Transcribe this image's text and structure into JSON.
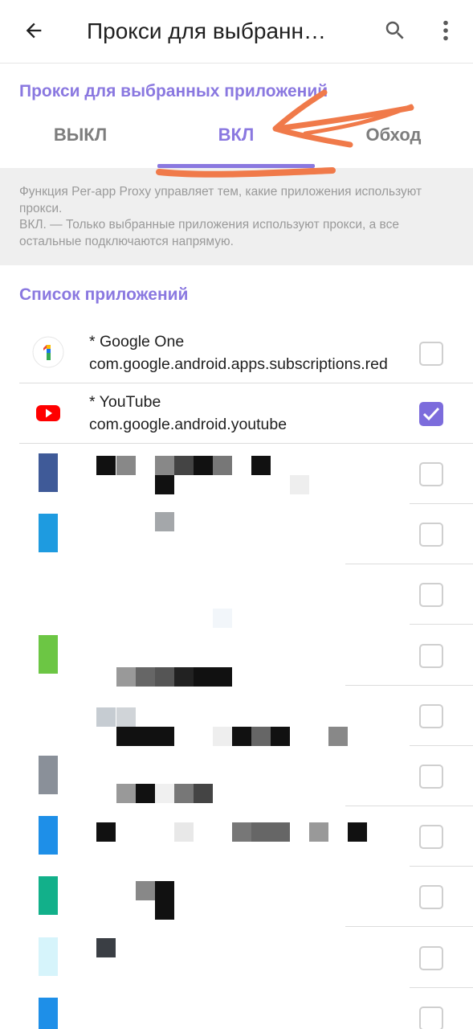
{
  "appbar": {
    "title": "Прокси для выбранн…",
    "back_icon": "arrow-back-icon",
    "search_icon": "search-icon",
    "more_icon": "more-vert-icon"
  },
  "mode_section": {
    "title": "Прокси для выбранных приложений",
    "tabs": [
      {
        "label": "ВЫКЛ",
        "selected": false
      },
      {
        "label": "ВКЛ",
        "selected": true
      },
      {
        "label": "Обход",
        "selected": false
      }
    ]
  },
  "description": {
    "line1": "Функция Per-app Proxy управляет тем, какие приложения используют прокси.",
    "line2": "ВКЛ. — Только выбранные приложения используют прокси, а все остальные подключаются напрямую."
  },
  "app_list": {
    "title": "Список приложений",
    "apps": [
      {
        "name": "* Google One",
        "package": "com.google.android.apps.subscriptions.red",
        "checked": false,
        "icon": "google-one-icon"
      },
      {
        "name": "* YouTube",
        "package": "com.google.android.youtube",
        "checked": true,
        "icon": "youtube-icon"
      }
    ],
    "hidden_rows_checked": [
      false,
      false,
      false,
      false,
      false,
      false,
      false,
      false,
      false,
      false
    ]
  },
  "colors": {
    "accent": "#8a78e0",
    "checkbox_checked": "#7c6cdc",
    "annotation": "#f07a4a",
    "description_bg": "#efefef"
  }
}
